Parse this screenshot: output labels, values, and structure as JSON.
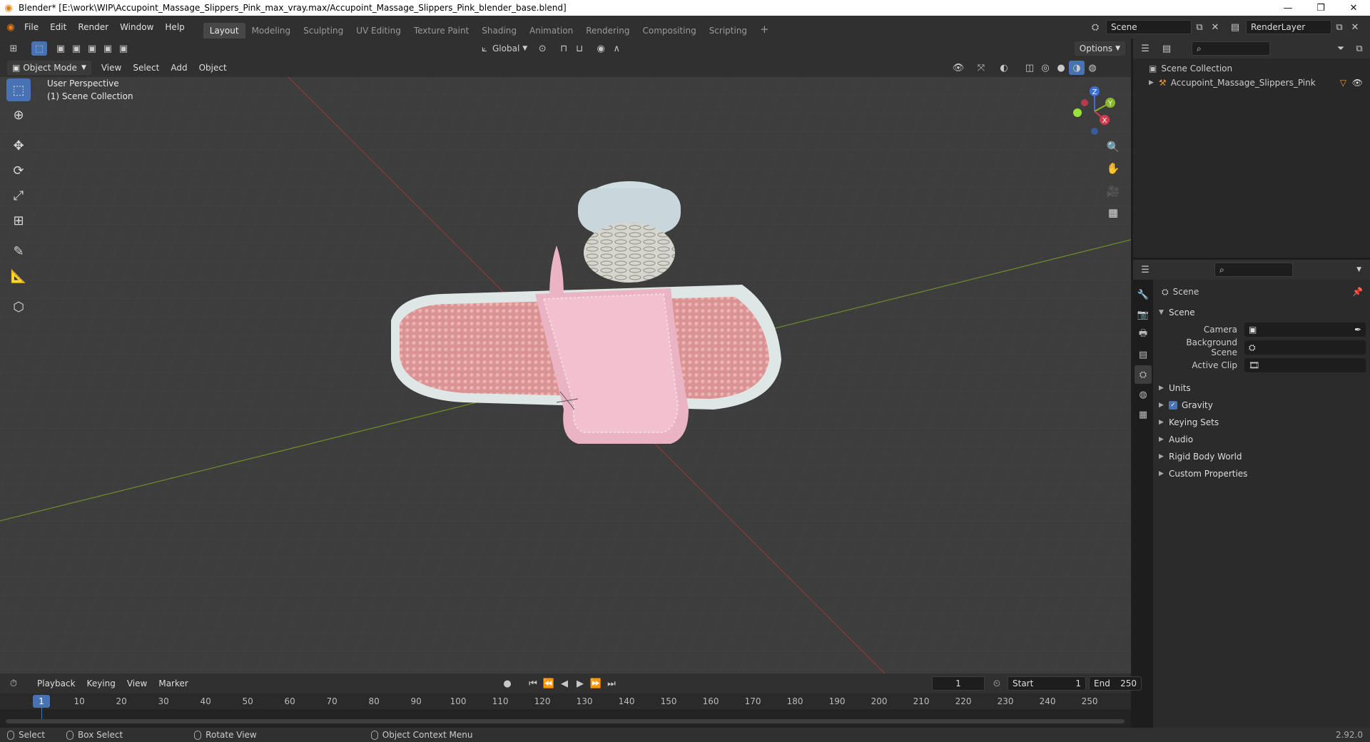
{
  "titlebar": {
    "title": "Blender* [E:\\work\\WIP\\Accupoint_Massage_Slippers_Pink_max_vray.max/Accupoint_Massage_Slippers_Pink_blender_base.blend]",
    "minimize": "—",
    "maximize": "❐",
    "close": "✕"
  },
  "menubar": [
    "File",
    "Edit",
    "Render",
    "Window",
    "Help"
  ],
  "workspaces": [
    "Layout",
    "Modeling",
    "Sculpting",
    "UV Editing",
    "Texture Paint",
    "Shading",
    "Animation",
    "Rendering",
    "Compositing",
    "Scripting"
  ],
  "add_workspace": "+",
  "scene_field": "Scene",
  "renderlayer_field": "RenderLayer",
  "viewport": {
    "transform_orientation": "Global",
    "options_label": "Options",
    "mode": "Object Mode",
    "menus": [
      "View",
      "Select",
      "Add",
      "Object"
    ],
    "perspective_label": "User Perspective",
    "collection_label": "(1) Scene Collection",
    "gizmo": {
      "x": "X",
      "y": "Y",
      "z": "Z"
    }
  },
  "outliner": {
    "collection": "Scene Collection",
    "object": "Accupoint_Massage_Slippers_Pink"
  },
  "properties": {
    "breadcrumb": "Scene",
    "section": "Scene",
    "fields": [
      {
        "label": "Camera",
        "value": ""
      },
      {
        "label": "Background Scene",
        "value": ""
      },
      {
        "label": "Active Clip",
        "value": ""
      }
    ],
    "panels": [
      {
        "label": "Units",
        "checkbox": false
      },
      {
        "label": "Gravity",
        "checkbox": true
      },
      {
        "label": "Keying Sets",
        "checkbox": false
      },
      {
        "label": "Audio",
        "checkbox": false
      },
      {
        "label": "Rigid Body World",
        "checkbox": false
      },
      {
        "label": "Custom Properties",
        "checkbox": false
      }
    ]
  },
  "timeline": {
    "menus": [
      "Playback",
      "Keying",
      "View",
      "Marker"
    ],
    "current_frame": "1",
    "start_label": "Start",
    "start_value": "1",
    "end_label": "End",
    "end_value": "250",
    "ticks": [
      "10",
      "20",
      "30",
      "40",
      "50",
      "60",
      "70",
      "80",
      "90",
      "100",
      "110",
      "120",
      "130",
      "140",
      "150",
      "160",
      "170",
      "180",
      "190",
      "200",
      "210",
      "220",
      "230",
      "240",
      "250"
    ],
    "cursor_label": "1"
  },
  "statusbar": {
    "select": "Select",
    "box_select": "Box Select",
    "rotate_view": "Rotate View",
    "context_menu": "Object Context Menu",
    "version": "2.92.0"
  }
}
